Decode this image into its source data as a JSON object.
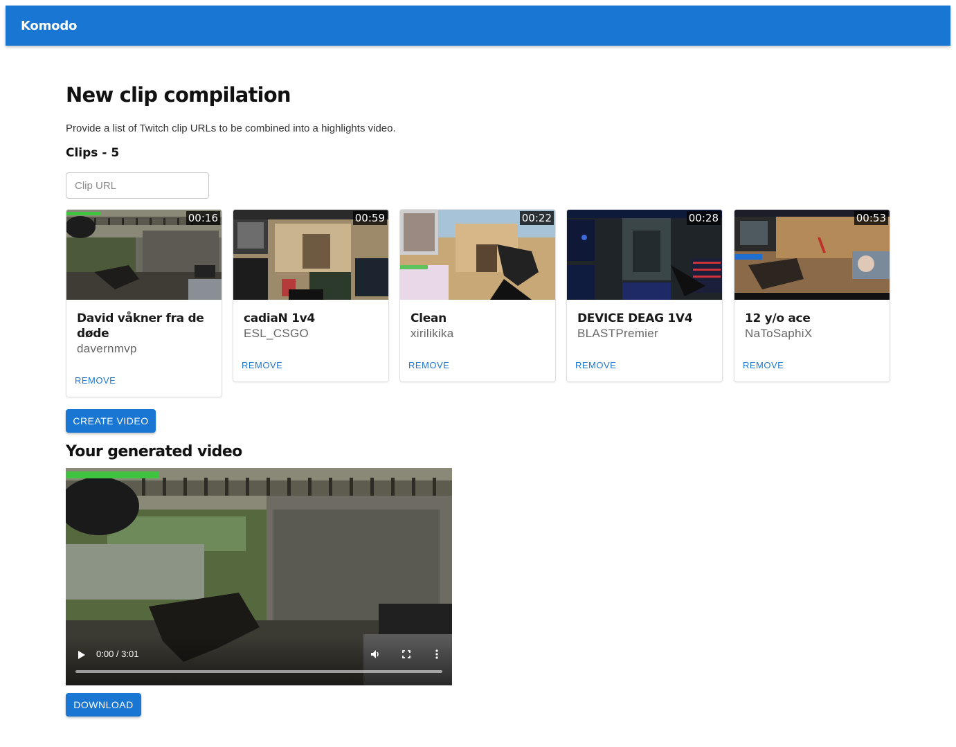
{
  "app": {
    "brand": "Komodo"
  },
  "page": {
    "title": "New clip compilation",
    "description": "Provide a list of Twitch clip URLs to be combined into a highlights video.",
    "clips_label": "Clips - ",
    "clips_count": "5"
  },
  "input": {
    "placeholder": "Clip URL",
    "value": ""
  },
  "clips": [
    {
      "title": "David våkner fra de døde",
      "author": "davernmvp",
      "duration": "00:16",
      "remove_label": "REMOVE"
    },
    {
      "title": "cadiaN 1v4",
      "author": "ESL_CSGO",
      "duration": "00:59",
      "remove_label": "REMOVE"
    },
    {
      "title": "Clean",
      "author": "xirilikika",
      "duration": "00:22",
      "remove_label": "REMOVE"
    },
    {
      "title": "DEVICE DEAG 1V4",
      "author": "BLASTPremier",
      "duration": "00:28",
      "remove_label": "REMOVE"
    },
    {
      "title": "12 y/o ace",
      "author": "NaToSaphiX",
      "duration": "00:53",
      "remove_label": "REMOVE"
    }
  ],
  "actions": {
    "create_label": "CREATE VIDEO",
    "download_label": "DOWNLOAD"
  },
  "video_section": {
    "heading": "Your generated video",
    "time": "0:00 / 3:01",
    "progress": 0.0,
    "icons": [
      "play-icon",
      "volume-icon",
      "fullscreen-icon",
      "more-options-icon"
    ]
  },
  "colors": {
    "primary": "#1976d2",
    "appbar_text": "#ffffff",
    "link": "#1976d2"
  }
}
